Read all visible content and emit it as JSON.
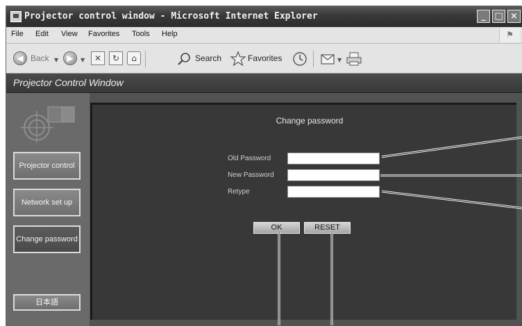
{
  "window": {
    "title": "Projector control window - Microsoft Internet Explorer",
    "controls": {
      "minimize": "_",
      "maximize": "□",
      "close": "×"
    }
  },
  "menubar": {
    "items": [
      "File",
      "Edit",
      "View",
      "Favorites",
      "Tools",
      "Help"
    ]
  },
  "toolbar": {
    "back_label": "Back",
    "search_label": "Search",
    "favorites_label": "Favorites",
    "icons": [
      "back-icon",
      "forward-icon",
      "stop-icon",
      "refresh-icon",
      "home-icon",
      "search-icon",
      "favorites-icon",
      "history-icon",
      "mail-icon",
      "print-icon"
    ]
  },
  "app": {
    "title": "Projector Control Window"
  },
  "sidebar": {
    "items": [
      {
        "label": "Projector control"
      },
      {
        "label": "Network set up"
      },
      {
        "label": "Change password"
      },
      {
        "label": "日本語"
      }
    ],
    "active_index": 2
  },
  "form": {
    "title": "Change password",
    "fields": [
      {
        "label": "Old Password",
        "value": ""
      },
      {
        "label": "New Password",
        "value": ""
      },
      {
        "label": "Retype",
        "value": ""
      }
    ],
    "ok_label": "OK",
    "reset_label": "RESET"
  },
  "colors": {
    "panel": "#383838",
    "sidebar": "#6a6a6a",
    "titlebar": "#2c2c2c"
  }
}
